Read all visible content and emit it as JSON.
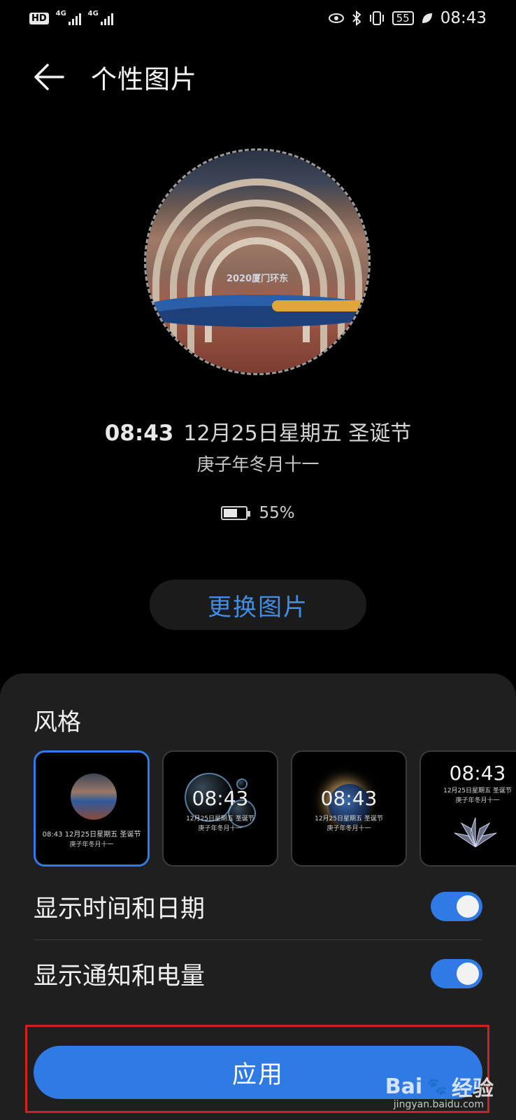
{
  "status_bar": {
    "hd": "HD",
    "sim1": "4G",
    "sim2": "4G",
    "battery": "55",
    "time": "08:43"
  },
  "header": {
    "title": "个性图片"
  },
  "preview": {
    "photo_text": "2020厦门环东",
    "time": "08:43",
    "date": "12月25日星期五  圣诞节",
    "lunar": "庚子年冬月十一",
    "battery": "55%"
  },
  "change_button": "更换图片",
  "sheet": {
    "title": "风格",
    "styles": [
      {
        "time": "08:43",
        "date": "12月25日星期五  圣诞节",
        "lunar": "庚子年冬月十一",
        "selected": true
      },
      {
        "time": "08:43",
        "date": "12月25日星期五  圣诞节",
        "lunar": "庚子年冬月十一",
        "selected": false
      },
      {
        "time": "08:43",
        "date": "12月25日星期五  圣诞节",
        "lunar": "庚子年冬月十一",
        "selected": false
      },
      {
        "time": "08:43",
        "date": "12月25日星期五  圣诞节",
        "lunar": "庚子年冬月十一",
        "selected": false
      }
    ],
    "show_time_date": {
      "label": "显示时间和日期",
      "enabled": true
    },
    "show_notify_battery": {
      "label": "显示通知和电量",
      "enabled": true
    },
    "apply": "应用"
  },
  "watermark": {
    "brand": "Bai",
    "brand2": "经验",
    "url": "jingyan.baidu.com"
  },
  "colors": {
    "accent": "#2f7ae5",
    "link": "#3f8ee8",
    "sheet_bg": "#1f1f1f",
    "highlight": "#d31e22"
  }
}
